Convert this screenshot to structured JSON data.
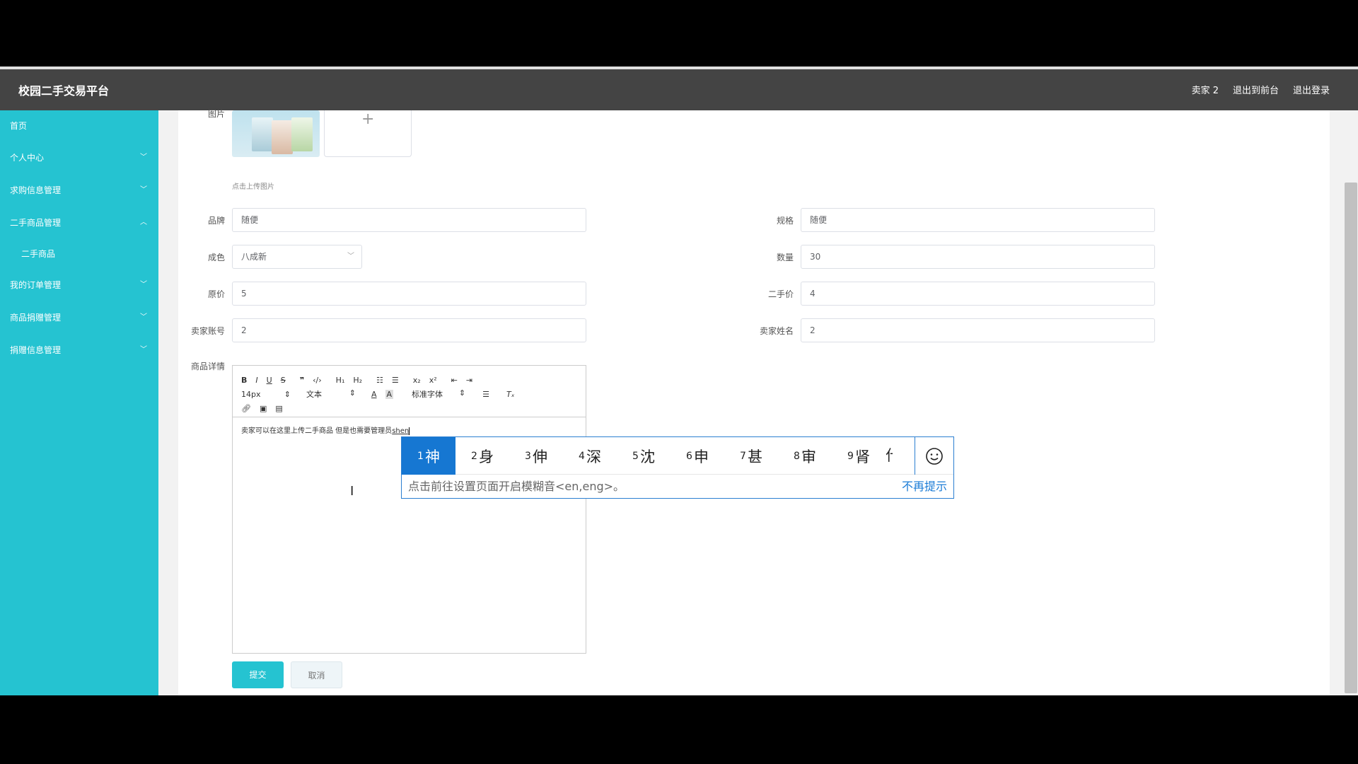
{
  "app": {
    "title": "校园二手交易平台",
    "header_links": [
      "卖家 2",
      "退出到前台",
      "退出登录"
    ]
  },
  "sidebar": {
    "items": [
      {
        "label": "首页",
        "expandable": false
      },
      {
        "label": "个人中心",
        "expandable": true,
        "expanded": false
      },
      {
        "label": "求购信息管理",
        "expandable": true,
        "expanded": false
      },
      {
        "label": "二手商品管理",
        "expandable": true,
        "expanded": true
      },
      {
        "label": "我的订单管理",
        "expandable": true,
        "expanded": false
      },
      {
        "label": "商品捐赠管理",
        "expandable": true,
        "expanded": false
      },
      {
        "label": "捐赠信息管理",
        "expandable": true,
        "expanded": false
      }
    ],
    "sub_item": "二手商品"
  },
  "form": {
    "image_label": "图片",
    "upload_tip": "点击上传图片",
    "brand": {
      "label": "品牌",
      "value": "随便"
    },
    "spec": {
      "label": "规格",
      "value": "随便"
    },
    "condition": {
      "label": "成色",
      "value": "八成新"
    },
    "quantity": {
      "label": "数量",
      "value": "30"
    },
    "original_price": {
      "label": "原价",
      "value": "5"
    },
    "used_price": {
      "label": "二手价",
      "value": "4"
    },
    "seller_account": {
      "label": "卖家账号",
      "value": "2"
    },
    "seller_name": {
      "label": "卖家姓名",
      "value": "2"
    },
    "detail_label": "商品详情",
    "editor": {
      "font_size": "14px",
      "text_type": "文本",
      "font_family": "标准字体",
      "content": "卖家可以在这里上传二手商品 但是也需要管理员",
      "composing": "shen"
    },
    "submit_label": "提交",
    "cancel_label": "取消"
  },
  "ime": {
    "candidates": [
      {
        "num": "1",
        "char": "神"
      },
      {
        "num": "2",
        "char": "身"
      },
      {
        "num": "3",
        "char": "伸"
      },
      {
        "num": "4",
        "char": "深"
      },
      {
        "num": "5",
        "char": "沈"
      },
      {
        "num": "6",
        "char": "申"
      },
      {
        "num": "7",
        "char": "甚"
      },
      {
        "num": "8",
        "char": "审"
      },
      {
        "num": "9",
        "char": "肾"
      }
    ],
    "overflow_char": "什",
    "hint": "点击前往设置页面开启模糊音<en,eng>。",
    "dismiss": "不再提示"
  },
  "colors": {
    "sidebar": "#25c3d1",
    "header": "#444444",
    "ime_accent": "#1677d2"
  }
}
